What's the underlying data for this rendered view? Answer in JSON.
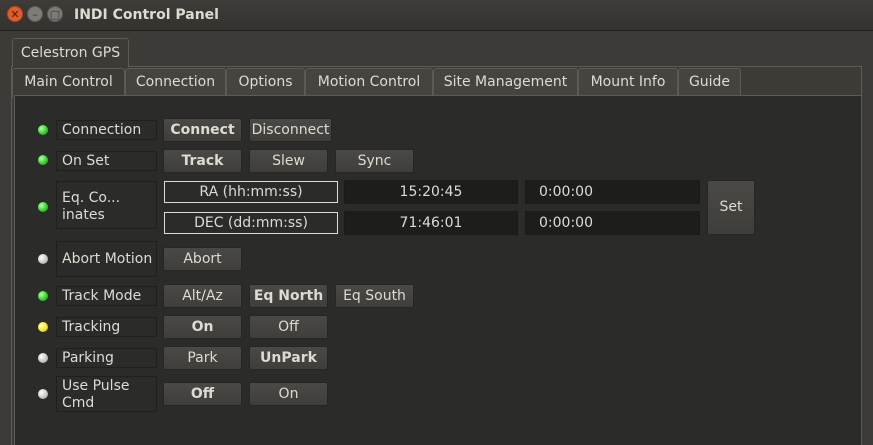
{
  "window": {
    "title": "INDI Control Panel"
  },
  "device_tab": {
    "label": "Celestron GPS"
  },
  "tabs": [
    {
      "label": "Main Control"
    },
    {
      "label": "Connection"
    },
    {
      "label": "Options"
    },
    {
      "label": "Motion Control"
    },
    {
      "label": "Site Management"
    },
    {
      "label": "Mount Info"
    },
    {
      "label": "Guide"
    }
  ],
  "properties": {
    "connection": {
      "label": "Connection",
      "status": "ok",
      "buttons": [
        "Connect",
        "Disconnect"
      ]
    },
    "on_set": {
      "label": "On Set",
      "status": "ok",
      "buttons": [
        "Track",
        "Slew",
        "Sync"
      ]
    },
    "eq_coordinates": {
      "label": "Eq. Co... inates",
      "status": "ok",
      "ra": {
        "label": "RA (hh:mm:ss)",
        "value": "15:20:45",
        "target": "0:00:00"
      },
      "dec": {
        "label": "DEC (dd:mm:ss)",
        "value": "71:46:01",
        "target": "0:00:00"
      },
      "set_label": "Set"
    },
    "abort_motion": {
      "label": "Abort Motion",
      "status": "idle",
      "buttons": [
        "Abort"
      ]
    },
    "track_mode": {
      "label": "Track Mode",
      "status": "ok",
      "buttons": [
        "Alt/Az",
        "Eq North",
        "Eq South"
      ]
    },
    "tracking": {
      "label": "Tracking",
      "status": "busy",
      "buttons": [
        "On",
        "Off"
      ]
    },
    "parking": {
      "label": "Parking",
      "status": "idle",
      "buttons": [
        "Park",
        "UnPark"
      ]
    },
    "use_pulse_cmd": {
      "label": "Use Pulse Cmd",
      "status": "idle",
      "buttons": [
        "Off",
        "On"
      ]
    }
  },
  "colors": {
    "status_ok": "#34d12a",
    "status_busy": "#f4e628",
    "status_idle": "#c8c8c8",
    "close_button": "#e05d2c"
  }
}
